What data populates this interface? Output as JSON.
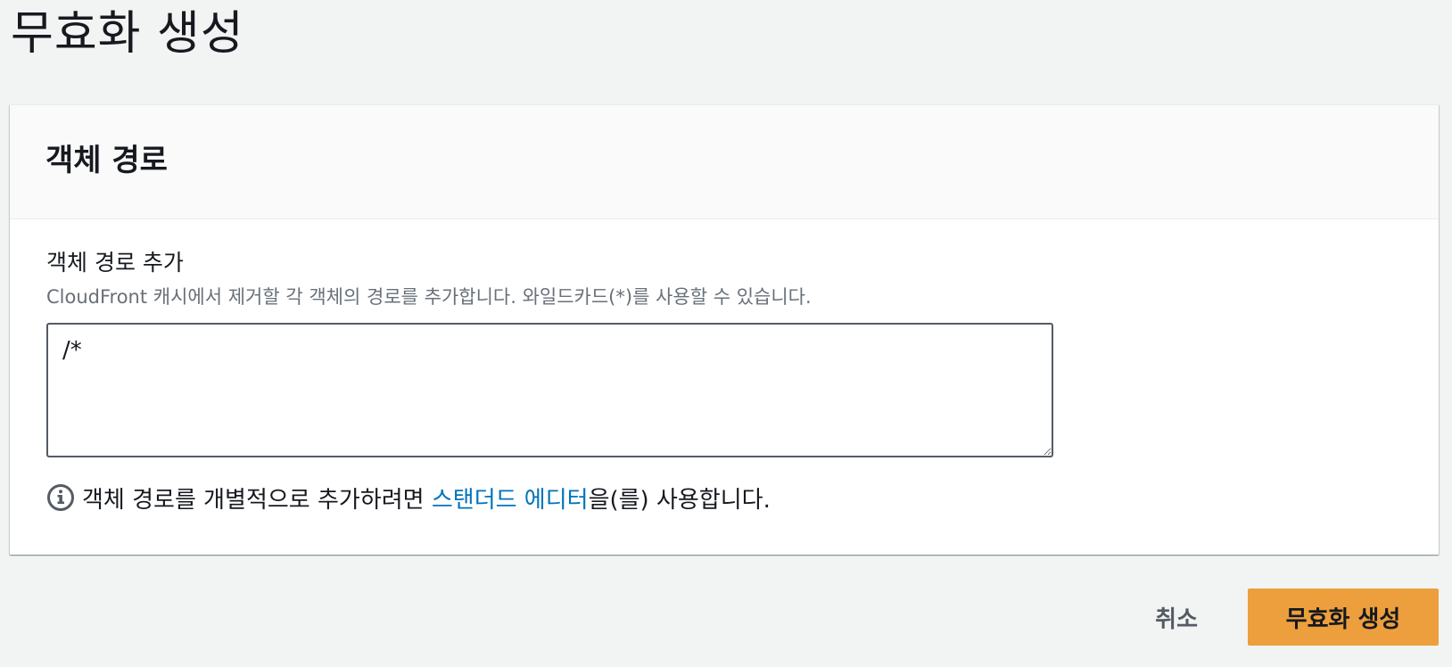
{
  "page": {
    "title": "무효화 생성"
  },
  "panel": {
    "title": "객체 경로",
    "field": {
      "label": "객체 경로 추가",
      "description": "CloudFront 캐시에서 제거할 각 객체의 경로를 추가합니다. 와일드카드(*)를 사용할 수 있습니다.",
      "value": "/*"
    },
    "info": {
      "icon": "info-icon",
      "prefix": "객체 경로를 개별적으로 추가하려면 ",
      "link_text": "스탠더드 에디터",
      "suffix": "을(를) 사용합니다."
    }
  },
  "actions": {
    "cancel_label": "취소",
    "submit_label": "무효화 생성"
  },
  "colors": {
    "background": "#f2f3f3",
    "link": "#0073bb",
    "primary_button": "#ec9f3c"
  }
}
